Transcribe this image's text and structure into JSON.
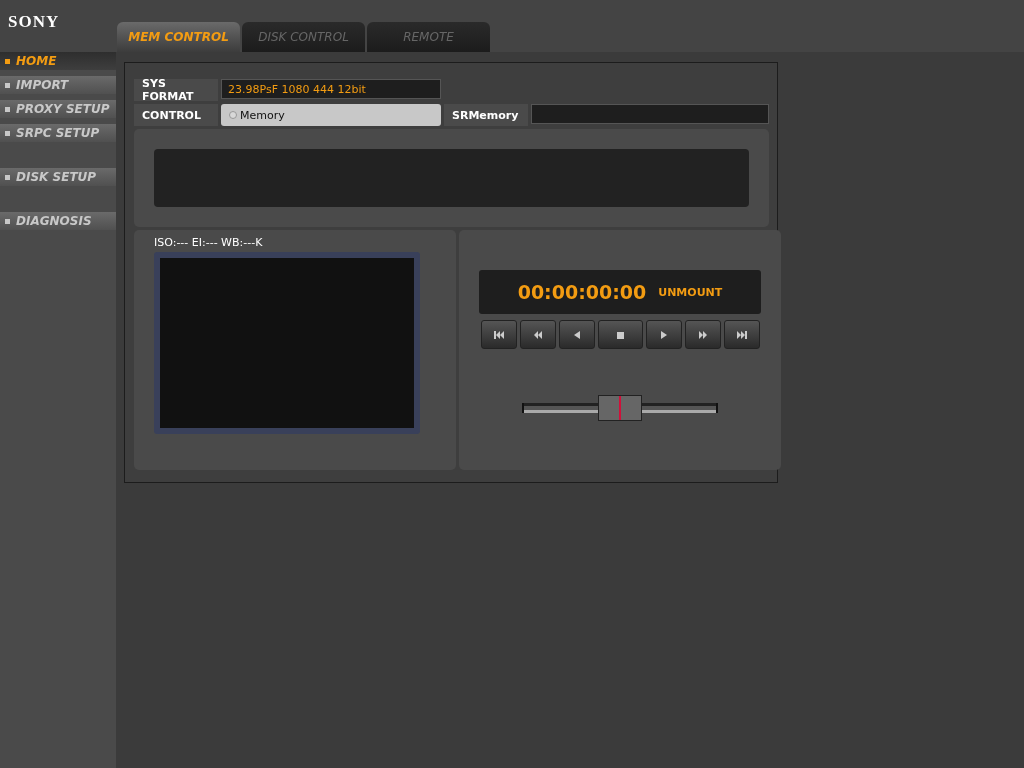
{
  "logo": "SONY",
  "tabs": [
    {
      "label": "MEM CONTROL",
      "selected": true
    },
    {
      "label": "DISK CONTROL",
      "selected": false
    },
    {
      "label": "REMOTE",
      "selected": false
    }
  ],
  "sidebar": {
    "groups": [
      [
        {
          "label": "HOME",
          "selected": true
        },
        {
          "label": "IMPORT",
          "selected": false
        },
        {
          "label": "PROXY SETUP",
          "selected": false
        },
        {
          "label": "SRPC SETUP",
          "selected": false
        }
      ],
      [
        {
          "label": "DISK SETUP",
          "selected": false
        }
      ],
      [
        {
          "label": "DIAGNOSIS",
          "selected": false
        }
      ]
    ]
  },
  "sys_format": {
    "label": "SYS FORMAT",
    "value": "23.98PsF 1080 444 12bit"
  },
  "control": {
    "label": "CONTROL",
    "option": {
      "label": "Memory",
      "selected": false
    },
    "srmemory_label": "SRMemory"
  },
  "viewer": {
    "info": "ISO:--- EI:--- WB:---K"
  },
  "transport": {
    "timecode": "00:00:00:00",
    "status": "UNMOUNT",
    "buttons": [
      {
        "kind": "first"
      },
      {
        "kind": "rewind"
      },
      {
        "kind": "reverse"
      },
      {
        "kind": "stop"
      },
      {
        "kind": "play"
      },
      {
        "kind": "forward"
      },
      {
        "kind": "last"
      }
    ],
    "shuttle": {
      "level": 0.5
    }
  }
}
